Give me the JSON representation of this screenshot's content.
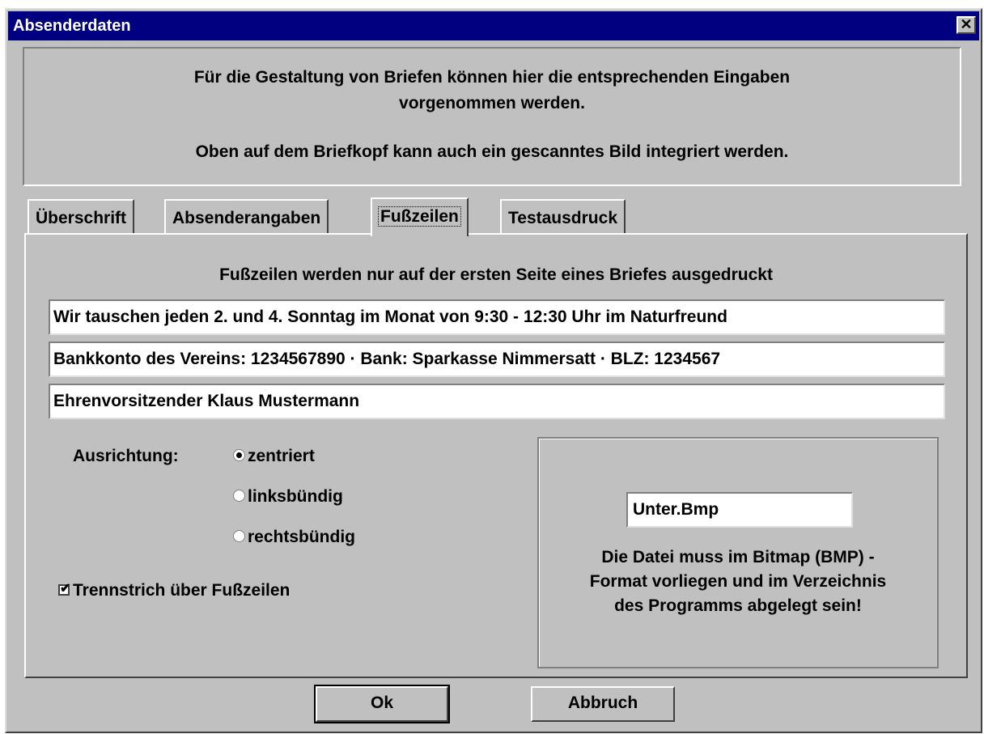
{
  "window": {
    "title": "Absenderdaten",
    "close_glyph": "✕"
  },
  "info": {
    "line1": "Für die Gestaltung von Briefen können hier die entsprechenden Eingaben vorgenommen werden.",
    "line2": "Oben auf dem Briefkopf kann auch ein gescanntes Bild integriert werden."
  },
  "tabs": [
    {
      "label": "Überschrift",
      "active": false
    },
    {
      "label": "Absenderangaben",
      "active": false
    },
    {
      "label": "Fußzeilen",
      "active": true
    },
    {
      "label": "Testausdruck",
      "active": false
    }
  ],
  "footer": {
    "note": "Fußzeilen werden nur auf der ersten Seite eines Briefes ausgedruckt",
    "lines": [
      "Wir tauschen jeden 2. und 4. Sonntag im Monat von 9:30 - 12:30 Uhr im Naturfreund",
      "Bankkonto des Vereins: 1234567890 · Bank: Sparkasse Nimmersatt · BLZ: 1234567",
      "Ehrenvorsitzender Klaus Mustermann"
    ]
  },
  "alignment": {
    "label": "Ausrichtung:",
    "options": [
      "zentriert",
      "linksbündig",
      "rechtsbündig"
    ],
    "selected": "zentriert"
  },
  "separator": {
    "label": "Trennstrich über Fußzeilen",
    "checked": true
  },
  "bitmap": {
    "filename": "Unter.Bmp",
    "note_lines": [
      "Die Datei muss im Bitmap (BMP) -",
      "Format vorliegen und im Verzeichnis",
      "des Programms abgelegt sein!"
    ]
  },
  "buttons": {
    "ok": "Ok",
    "cancel": "Abbruch"
  }
}
